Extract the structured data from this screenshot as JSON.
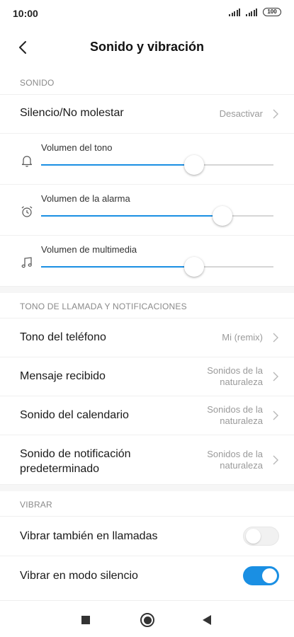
{
  "status_bar": {
    "time": "10:00",
    "battery": "100",
    "icons": [
      "signal-icon",
      "signal-icon",
      "battery-icon"
    ]
  },
  "header": {
    "title": "Sonido y vibración",
    "back_icon": "chevron-left-icon"
  },
  "sections": {
    "sound": {
      "header": "SONIDO",
      "silence": {
        "label": "Silencio/No molestar",
        "value": "Desactivar"
      },
      "ringer_volume": {
        "label": "Volumen del tono",
        "icon": "bell-icon",
        "level": 0.66
      },
      "alarm_volume": {
        "label": "Volumen de la alarma",
        "icon": "alarm-clock-icon",
        "level": 0.78
      },
      "media_volume": {
        "label": "Volumen de multimedia",
        "icon": "music-note-icon",
        "level": 0.66
      }
    },
    "ringtones": {
      "header": "TONO DE LLAMADA Y NOTIFICACIONES",
      "items": [
        {
          "label": "Tono del teléfono",
          "value": "Mi (remix)"
        },
        {
          "label": "Mensaje recibido",
          "value": "Sonidos de la naturaleza"
        },
        {
          "label": "Sonido del calendario",
          "value": "Sonidos de la naturaleza"
        },
        {
          "label": "Sonido de notificación predeterminado",
          "value": "Sonidos de la naturaleza"
        }
      ]
    },
    "vibrate": {
      "header": "VIBRAR",
      "items": [
        {
          "label": "Vibrar también en llamadas",
          "enabled": false
        },
        {
          "label": "Vibrar en modo silencio",
          "enabled": true
        }
      ]
    }
  },
  "nav_bar": {
    "icons": [
      "recents-square-icon",
      "home-circle-icon",
      "back-triangle-icon"
    ]
  },
  "colors": {
    "accent": "#1a8fe3",
    "secondary_text": "#9a9a9a",
    "section_gap": "#f6f6f6"
  }
}
